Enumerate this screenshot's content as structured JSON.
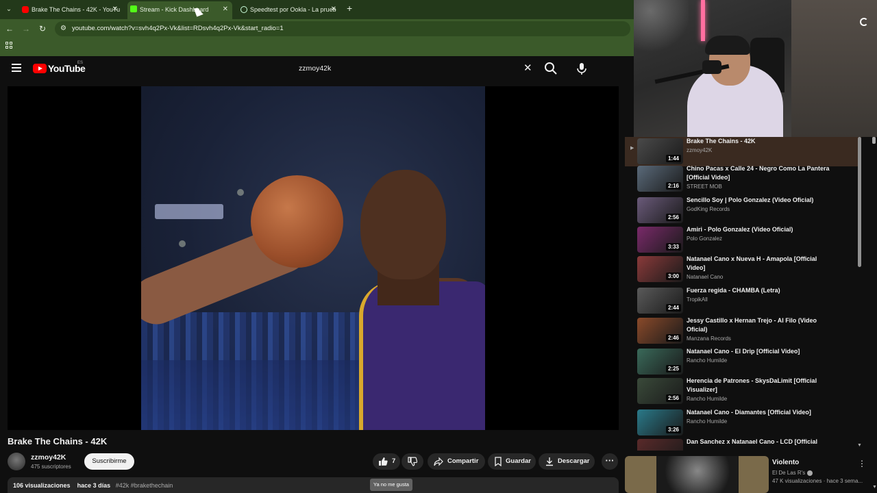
{
  "browser": {
    "tabs": [
      {
        "label": "Brake The Chains - 42K - YouTu",
        "favicon_color": "#ff0000"
      },
      {
        "label": "Stream - Kick Dashboard",
        "favicon_color": "#53fc18"
      },
      {
        "label": "Speedtest por Ookla - La prueb",
        "favicon_color": "#2a2a2a"
      }
    ],
    "url": "youtube.com/watch?v=svh4q2Px-Vk&list=RDsvh4q2Px-Vk&start_radio=1",
    "accent": "#3b5a2a"
  },
  "youtube": {
    "logo": "YouTube",
    "region": "ES",
    "search_value": "zzmoy42k",
    "brand_color": "#ff0000"
  },
  "video": {
    "title": "Brake The Chains - 42K",
    "channel": "zzmoy42K",
    "subscribers": "475 suscriptores",
    "subscribe_label": "Suscribirme",
    "like_count": "7",
    "share_label": "Compartir",
    "save_label": "Guardar",
    "download_label": "Descargar",
    "tooltip": "Ya no me gusta",
    "views": "106 visualizaciones",
    "date": "hace 3 días",
    "tags": "#42k #brakethechain"
  },
  "playlist": [
    {
      "title": "Brake The Chains - 42K",
      "channel": "zzmoy42K",
      "duration": "1:44",
      "thumb": "#4a4a4a",
      "current": true
    },
    {
      "title": "Chino Pacas x Calle 24 - Negro Como La Pantera [Official Video]",
      "channel": "STREET MOB",
      "duration": "2:16",
      "thumb": "#5a6a7a"
    },
    {
      "title": "Sencillo Soy | Polo Gonzalez (Video Oficial)",
      "channel": "GodKing Records",
      "duration": "2:56",
      "thumb": "#6a5a7a"
    },
    {
      "title": "Amiri - Polo Gonzalez (Video Oficial)",
      "channel": "Polo Gonzalez",
      "duration": "3:33",
      "thumb": "#7a2a6a"
    },
    {
      "title": "Natanael Cano x Nueva H - Amapola [Official Video]",
      "channel": "Natanael Cano",
      "duration": "3:00",
      "thumb": "#8a3a3a"
    },
    {
      "title": "Fuerza regida - CHAMBA (Letra)",
      "channel": "TropikAll",
      "duration": "2:44",
      "thumb": "#5a5a5a"
    },
    {
      "title": "Jessy Castillo x Hernan Trejo - Al Filo (Video Oficial)",
      "channel": "Manzana Records",
      "duration": "2:46",
      "thumb": "#8a4a2a"
    },
    {
      "title": "Natanael Cano - El Drip [Official Video]",
      "channel": "Rancho Humilde",
      "duration": "2:25",
      "thumb": "#3a6a5a"
    },
    {
      "title": "Herencia de Patrones - SkysDaLimit [Official Visualizer]",
      "channel": "Rancho Humilde",
      "duration": "2:56",
      "thumb": "#3a4a3a"
    },
    {
      "title": "Natanael Cano - Diamantes [Official Video]",
      "channel": "Rancho Humilde",
      "duration": "3:26",
      "thumb": "#2a7a8a"
    },
    {
      "title": "Dan Sanchez x Natanael Cano - LCD [Official",
      "channel": "",
      "duration": "",
      "thumb": "#5a2a2a"
    }
  ],
  "recommended": {
    "title": "Violento",
    "channel": "El De Las R's",
    "meta": "47 K visualizaciones · hace 3 sema..."
  }
}
